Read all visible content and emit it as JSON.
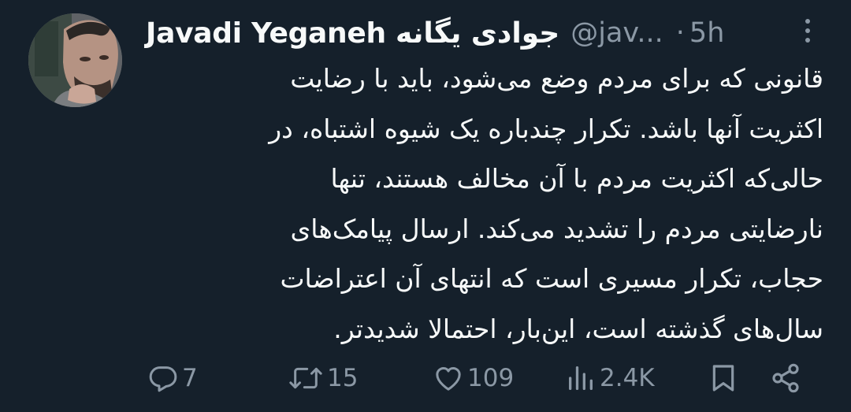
{
  "tweet": {
    "author": {
      "display_name": "Javadi Yeganeh جوادی یگانه",
      "handle": "@jav...",
      "avatar_icon": "profile-photo"
    },
    "separator": "·",
    "timestamp": "5h",
    "lines": [
      "قانونی که برای مردم وضع می‌شود، باید با رضایت",
      "اکثریت آنها باشد. تکرار چندباره یک شیوه اشتباه، در",
      "حالی‌که اکثریت مردم با آن مخالف هستند، تنها",
      "نارضایتی مردم را تشدید می‌کند. ارسال پیامک‌های",
      "حجاب، تکرار مسیری است که انتهای آن اعتراضات",
      "سال‌های گذشته است، این‌بار، احتمالا شدیدتر."
    ],
    "actions": {
      "reply": {
        "icon": "reply-icon",
        "count": "7"
      },
      "retweet": {
        "icon": "retweet-icon",
        "count": "15"
      },
      "like": {
        "icon": "heart-icon",
        "count": "109"
      },
      "views": {
        "icon": "views-icon",
        "count": "2.4K"
      },
      "bookmark": {
        "icon": "bookmark-icon"
      },
      "share": {
        "icon": "share-icon"
      }
    }
  },
  "colors": {
    "background": "#15202b",
    "primary_text": "#f7f9f9",
    "secondary_text": "#8b98a5"
  }
}
